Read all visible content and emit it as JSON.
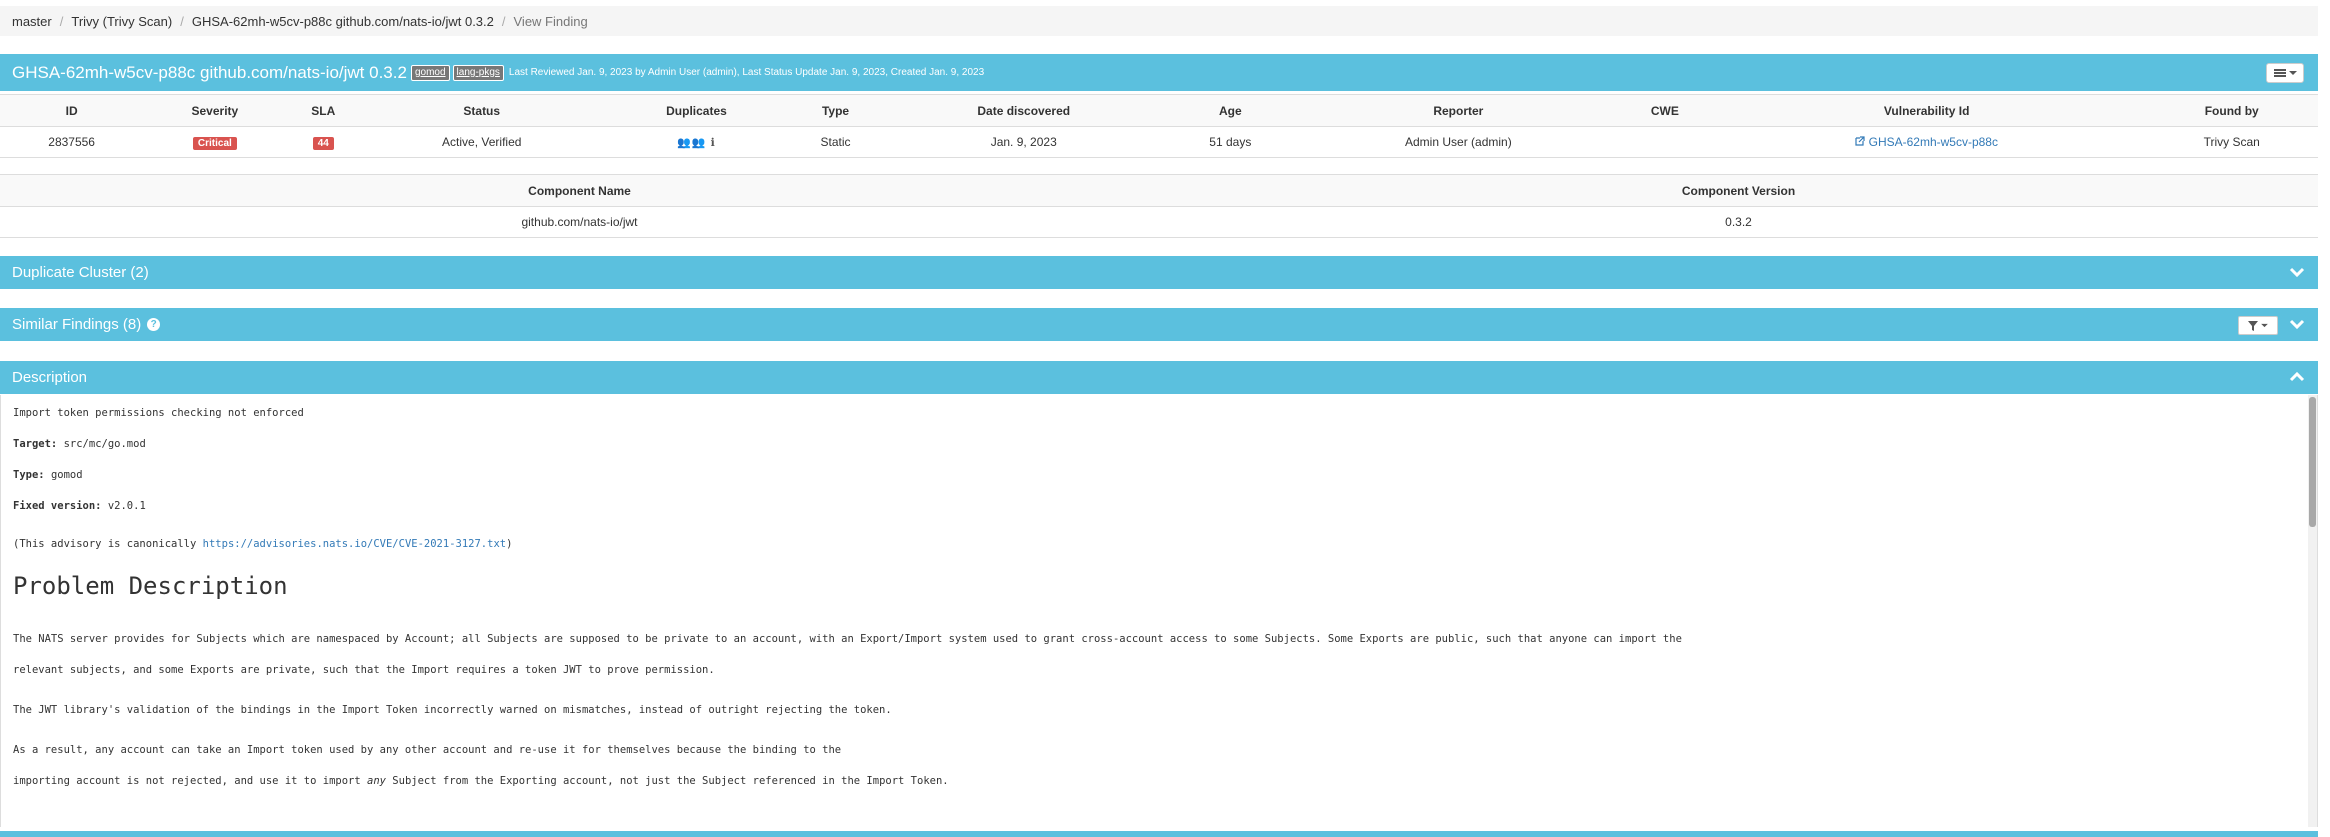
{
  "breadcrumb": {
    "items": [
      "master",
      "Trivy (Trivy Scan)",
      "GHSA-62mh-w5cv-p88c github.com/nats-io/jwt 0.3.2",
      "View Finding"
    ]
  },
  "finding": {
    "title": "GHSA-62mh-w5cv-p88c github.com/nats-io/jwt 0.3.2",
    "tags": [
      "gomod",
      "lang-pkgs"
    ],
    "meta": "Last Reviewed Jan. 9, 2023 by Admin User (admin), Last Status Update Jan. 9, 2023, Created Jan. 9, 2023"
  },
  "details_table": {
    "headers": [
      "ID",
      "Severity",
      "SLA",
      "Status",
      "Duplicates",
      "Type",
      "Date discovered",
      "Age",
      "Reporter",
      "CWE",
      "Vulnerability Id",
      "Found by"
    ],
    "row": {
      "id": "2837556",
      "severity": "Critical",
      "sla": "44",
      "status": "Active, Verified",
      "duplicates": "👥👥 ℹ",
      "type": "Static",
      "date_discovered": "Jan. 9, 2023",
      "age": "51 days",
      "reporter": "Admin User (admin)",
      "cwe": "",
      "vulnerability_id": "GHSA-62mh-w5cv-p88c",
      "found_by": "Trivy Scan"
    }
  },
  "component_table": {
    "headers": [
      "Component Name",
      "Component Version"
    ],
    "row": {
      "name": "github.com/nats-io/jwt",
      "version": "0.3.2"
    }
  },
  "sections": {
    "duplicate_cluster": "Duplicate Cluster (2)",
    "similar_findings": "Similar Findings (8)",
    "description": "Description"
  },
  "description": {
    "line1": "Import token permissions checking not enforced",
    "target_label": "Target:",
    "target_value": "src/mc/go.mod",
    "type_label": "Type:",
    "type_value": "gomod",
    "fixed_label": "Fixed version:",
    "fixed_value": "v2.0.1",
    "advisory_prefix": "(This advisory is canonically ",
    "advisory_link": "https://advisories.nats.io/CVE/CVE-2021-3127.txt",
    "advisory_suffix": ")",
    "heading": "Problem Description",
    "para1a": "The NATS server provides for Subjects which are namespaced by Account; all Subjects are supposed to be private to an account, with an Export/Import system used to grant cross-account access to some Subjects.  Some Exports are public, such that anyone can import the",
    "para1b": "relevant subjects, and some Exports are private, such that the Import requires a token JWT to prove permission.",
    "para2": "The JWT library's validation of the bindings in the Import Token incorrectly warned on mismatches, instead of outright rejecting the token.",
    "para3a": "As a result, any account can take an Import token used by any other account and re-use it for themselves because the binding to the",
    "para3b_pre": "importing account is not rejected, and use it to import ",
    "para3b_em": "any",
    "para3b_post": " Subject from the Exporting account, not just the Subject referenced in the Import Token."
  }
}
